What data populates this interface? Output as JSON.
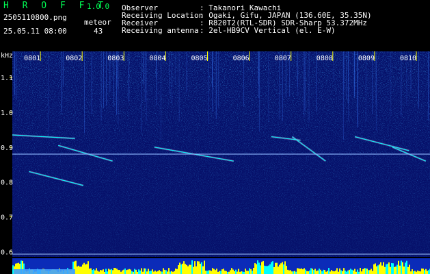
{
  "header": {
    "brand": "H R O F F T",
    "version": "1.0.0",
    "filename": "2505110800.png",
    "datetime": "25.05.11 08:00",
    "meteor_label": "meteor",
    "meteor_count": "43",
    "info_keys": [
      "Observer",
      "Receiving Location",
      "Receiver",
      "Receiving antenna"
    ],
    "info_values": [
      ": Takanori Kawachi",
      ": Ogaki, Gifu, JAPAN (136.60E, 35.35N)",
      ": R820T2(RTL-SDR) SDR-Sharp 53.372MHz",
      ": 2el-HB9CV Vertical (el. E-W)"
    ]
  },
  "colors": {
    "text_primary": "#ffffff",
    "header_green": "#00ff55",
    "axis_yellow": "#ffff00",
    "bg": "#000000",
    "plot_bg": "#06106a",
    "signal_cyan": "#00ffff"
  },
  "chart_data": {
    "type": "heatmap",
    "y_unit": "kHz",
    "y_ticks": [
      "1.1",
      "1.0",
      "0.9",
      "0.8",
      "0.7",
      "0.6"
    ],
    "y_tick_values": [
      1.1,
      1.0,
      0.9,
      0.8,
      0.7,
      0.6
    ],
    "ylim": [
      0.585,
      1.175
    ],
    "x_ticks": [
      "0801",
      "0802",
      "0803",
      "0804",
      "0805",
      "0806",
      "0807",
      "0808",
      "0809",
      "0810"
    ],
    "xlim": [
      0,
      10
    ],
    "carrier_khz": 0.88,
    "meteor_traces": [
      {
        "t0": 0.0,
        "f0": 0.935,
        "t1": 1.5,
        "f1": 0.925
      },
      {
        "t0": 1.1,
        "f0": 0.905,
        "t1": 2.4,
        "f1": 0.86
      },
      {
        "t0": 3.4,
        "f0": 0.9,
        "t1": 5.3,
        "f1": 0.86
      },
      {
        "t0": 0.4,
        "f0": 0.83,
        "t1": 1.7,
        "f1": 0.79
      },
      {
        "t0": 6.2,
        "f0": 0.93,
        "t1": 6.9,
        "f1": 0.92
      },
      {
        "t0": 6.7,
        "f0": 0.93,
        "t1": 7.5,
        "f1": 0.86
      },
      {
        "t0": 8.2,
        "f0": 0.93,
        "t1": 9.5,
        "f1": 0.89
      },
      {
        "t0": 9.1,
        "f0": 0.9,
        "t1": 9.9,
        "f1": 0.86
      }
    ]
  }
}
